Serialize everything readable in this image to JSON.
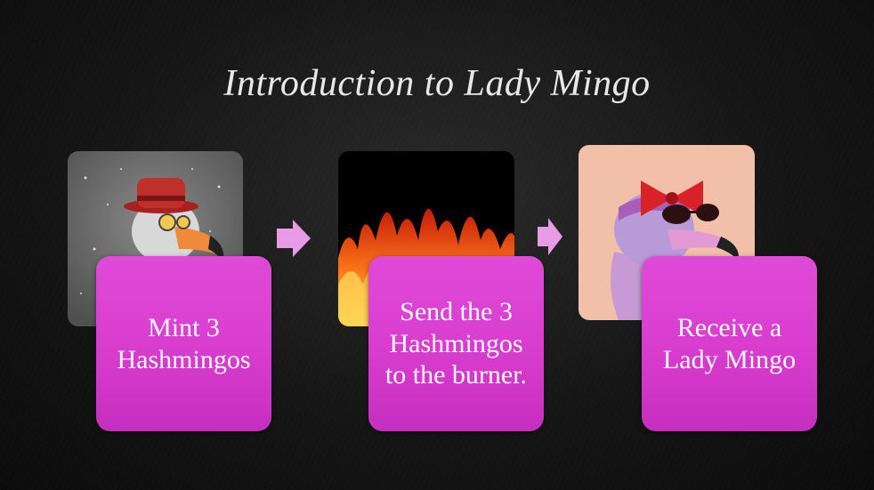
{
  "slide": {
    "title": "Introduction to Lady Mingo"
  },
  "steps": [
    {
      "label": "Mint 3 Hashmingos"
    },
    {
      "label": "Send the 3 Hashmingos to the burner."
    },
    {
      "label": "Receive a Lady Mingo"
    }
  ],
  "colors": {
    "background": "#1a1a1a",
    "box": "#d83ccf",
    "arrow": "#e79ae6",
    "title": "#e8e8e8"
  },
  "icons": [
    "arrow-right-icon",
    "arrow-right-icon"
  ]
}
